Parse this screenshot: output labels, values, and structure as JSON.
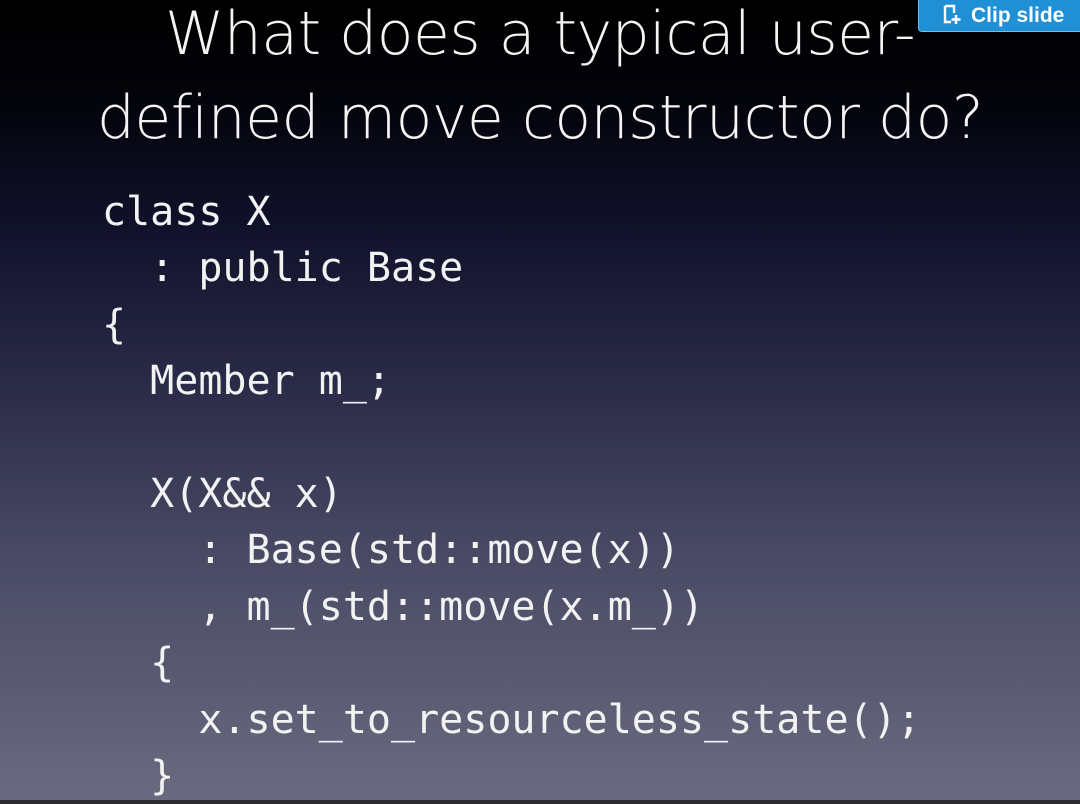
{
  "slide": {
    "title_lines": [
      "What does a typical user-",
      "defined move constructor do?"
    ],
    "code_lines": [
      "class X",
      "  : public Base",
      "{",
      "  Member m_;",
      "",
      "  X(X&& x)",
      "    : Base(std::move(x))",
      "    , m_(std::move(x.m_))",
      "  {",
      "    x.set_to_resourceless_state();",
      "  }"
    ]
  },
  "clip_button": {
    "label": "Clip slide",
    "icon": "clip-slide-icon",
    "color": "#1f8fd6"
  }
}
